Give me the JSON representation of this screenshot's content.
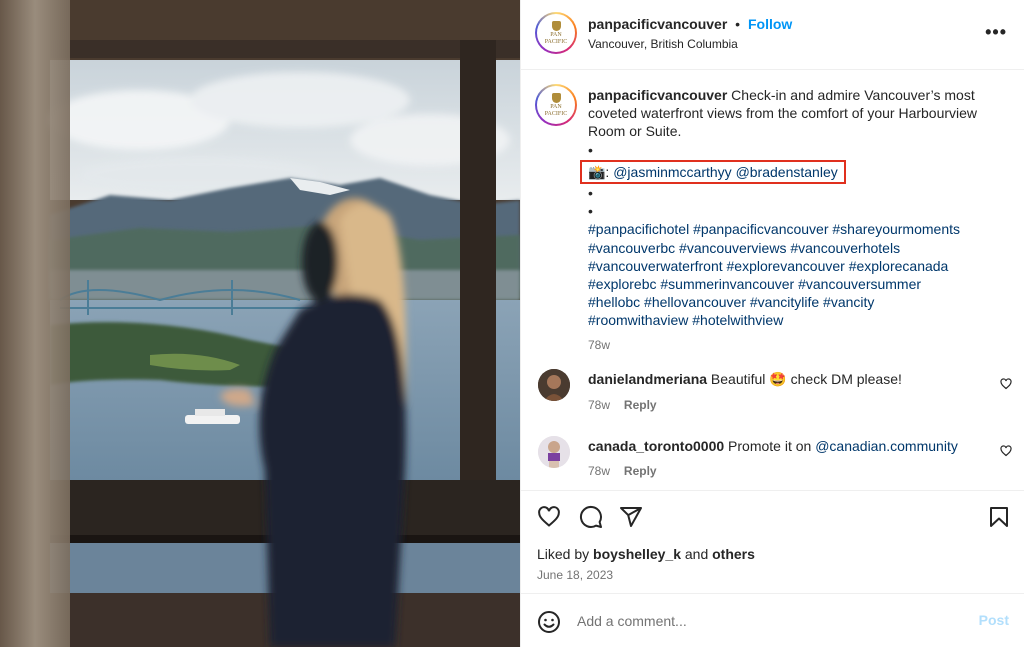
{
  "post": {
    "username": "panpacificvancouver",
    "separator": "•",
    "follow_label": "Follow",
    "location": "Vancouver, British Columbia",
    "more_label": "•••",
    "logo_text_line1": "PAN PACIFIC",
    "logo_text_line2": "VANCOUVER"
  },
  "caption": {
    "username": "panpacificvancouver",
    "text": " Check-in and admire Vancouver’s most coveted waterfront views from the comfort of your Harbourview Room or Suite.",
    "dot1": "•",
    "camera_emoji": "📸: ",
    "mention1": "@jasminmccarthyy",
    "mention2": "@bradenstanley",
    "dot2": "•",
    "dot3": "•",
    "hashtags": [
      "#panpacifichotel #panpacificvancouver #shareyourmoments",
      "#vancouverbc #vancouverviews #vancouverhotels",
      "#vancouverwaterfront #explorevancouver #explorecanada",
      "#explorebc #summerinvancouver #vancouversummer",
      "#hellobc #hellovancouver #vancitylife #vancity",
      "#roomwithaview #hotelwithview"
    ],
    "time": "78w"
  },
  "comments": [
    {
      "username": "danielandmeriana",
      "text": " Beautiful 🤩 check DM please!",
      "time": "78w",
      "reply_label": "Reply"
    },
    {
      "username": "canada_toronto0000",
      "text": " Promote it on ",
      "link": "@canadian.community",
      "time": "78w",
      "reply_label": "Reply"
    }
  ],
  "footer": {
    "liked_prefix": "Liked by ",
    "liked_user": "boyshelley_k",
    "liked_and": " and ",
    "liked_others": "others",
    "date": "June 18, 2023",
    "comment_placeholder": "Add a comment...",
    "post_label": "Post"
  },
  "icons": {
    "like": "heart-icon",
    "comment": "comment-icon",
    "share": "share-icon",
    "save": "bookmark-icon",
    "emoji": "emoji-icon",
    "more": "more-icon"
  },
  "colors": {
    "accent": "#0095f6",
    "link": "#00376b",
    "highlight_box": "#e0301e",
    "muted": "#737373"
  }
}
